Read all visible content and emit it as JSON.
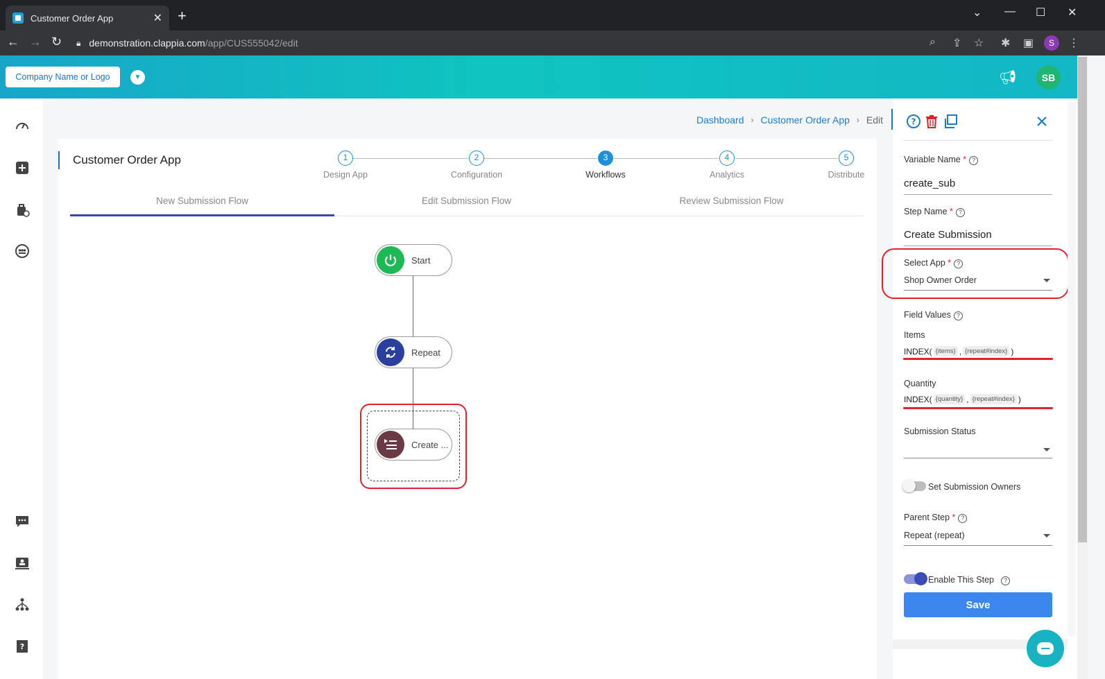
{
  "browser": {
    "tab_title": "Customer Order App",
    "url_host": "demonstration.clappia.com",
    "url_path": "/app/CUS555042/edit",
    "profile_initial": "S"
  },
  "header": {
    "logo_label": "Company Name or Logo",
    "user_initials": "SB"
  },
  "breadcrumb": {
    "items": [
      "Dashboard",
      "Customer Order App",
      "Edit"
    ]
  },
  "app": {
    "title": "Customer Order App"
  },
  "steps": [
    {
      "num": "1",
      "label": "Design App"
    },
    {
      "num": "2",
      "label": "Configuration"
    },
    {
      "num": "3",
      "label": "Workflows",
      "active": true
    },
    {
      "num": "4",
      "label": "Analytics"
    },
    {
      "num": "5",
      "label": "Distribute"
    }
  ],
  "flow_tabs": [
    "New Submission Flow",
    "Edit Submission Flow",
    "Review Submission Flow"
  ],
  "nodes": {
    "start": "Start",
    "repeat": "Repeat",
    "create": "Create ..."
  },
  "panel": {
    "variable_name_label": "Variable Name",
    "variable_name_value": "create_sub",
    "step_name_label": "Step Name",
    "step_name_value": "Create Submission",
    "select_app_label": "Select App",
    "select_app_value": "Shop Owner Order",
    "field_values_label": "Field Values",
    "items_label": "Items",
    "items_formula": {
      "fn": "INDEX(",
      "arg1": "{items}",
      "sep": ",",
      "arg2": "{repeat#index}",
      "close": ")"
    },
    "quantity_label": "Quantity",
    "quantity_formula": {
      "fn": "INDEX(",
      "arg1": "{quantity}",
      "sep": ",",
      "arg2": "{repeat#index}",
      "close": ")"
    },
    "submission_status_label": "Submission Status",
    "submission_status_value": "",
    "set_owners_label": "Set Submission Owners",
    "parent_step_label": "Parent Step",
    "parent_step_value": "Repeat (repeat)",
    "enable_step_label": "Enable This Step",
    "save_label": "Save",
    "required_mark": "*",
    "help_mark": "?"
  },
  "colors": {
    "accent": "#1e8fd8",
    "start_node": "#1db954",
    "repeat_node": "#2a3f9e",
    "create_node": "#6a3b44",
    "highlight": "#e2202e",
    "save": "#3c86f0"
  }
}
